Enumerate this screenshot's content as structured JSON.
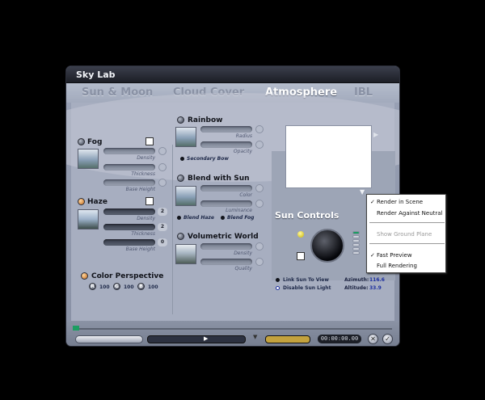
{
  "window": {
    "title": "Sky Lab"
  },
  "tabs": [
    {
      "label": "Sun & Moon",
      "active": false
    },
    {
      "label": "Cloud Cover",
      "active": false
    },
    {
      "label": "Atmosphere",
      "active": true
    },
    {
      "label": "IBL",
      "active": false
    }
  ],
  "fog": {
    "label": "Fog",
    "density": "Density",
    "thickness": "Thickness",
    "base_height": "Base Height"
  },
  "haze": {
    "label": "Haze",
    "density": "Density",
    "thickness": "Thickness",
    "base_height": "Base Height",
    "values": {
      "density": "2",
      "thickness": "2",
      "base_height": "0"
    }
  },
  "rainbow": {
    "label": "Rainbow",
    "radius": "Radius",
    "opacity": "Opacity",
    "secondary_bow": "Secondary Bow"
  },
  "blend_with_sun": {
    "label": "Blend with Sun",
    "color": "Color",
    "luminance": "Luminance",
    "blend_haze": "Blend Haze",
    "blend_fog": "Blend Fog"
  },
  "volumetric_world": {
    "label": "Volumetric World",
    "density": "Density",
    "quality": "Quality"
  },
  "color_perspective": {
    "label": "Color Perspective",
    "channels": [
      {
        "letter": "R",
        "value": "100"
      },
      {
        "letter": "G",
        "value": "100"
      },
      {
        "letter": "B",
        "value": "100"
      }
    ]
  },
  "sun_controls": {
    "title": "Sun Controls",
    "link_sun_to_view": "Link Sun To View",
    "disable_sun_light": "Disable Sun Light",
    "azimuth_label": "Azimuth:",
    "azimuth_value": "116.6",
    "altitude_label": "Altitude:",
    "altitude_value": "33.9"
  },
  "transport": {
    "time": "00:00:00.00"
  },
  "context_menu": {
    "items": [
      {
        "label": "Render in Scene",
        "checked": true,
        "disabled": false
      },
      {
        "label": "Render Against Neutral",
        "checked": false,
        "disabled": false
      },
      {
        "label": "Show Ground Plane",
        "checked": false,
        "disabled": true
      },
      {
        "label": "Fast Preview",
        "checked": true,
        "disabled": false
      },
      {
        "label": "Full Rendering",
        "checked": false,
        "disabled": false
      }
    ]
  },
  "icons": [
    "fog-toggle-icon",
    "haze-toggle-icon",
    "sun-dial-icon",
    "play-icon",
    "ok-icon",
    "cancel-icon"
  ],
  "colors": {
    "accent_orange": "#c46a1b",
    "link_blue": "#1d2fa0",
    "meter_green": "#1c9d62"
  }
}
